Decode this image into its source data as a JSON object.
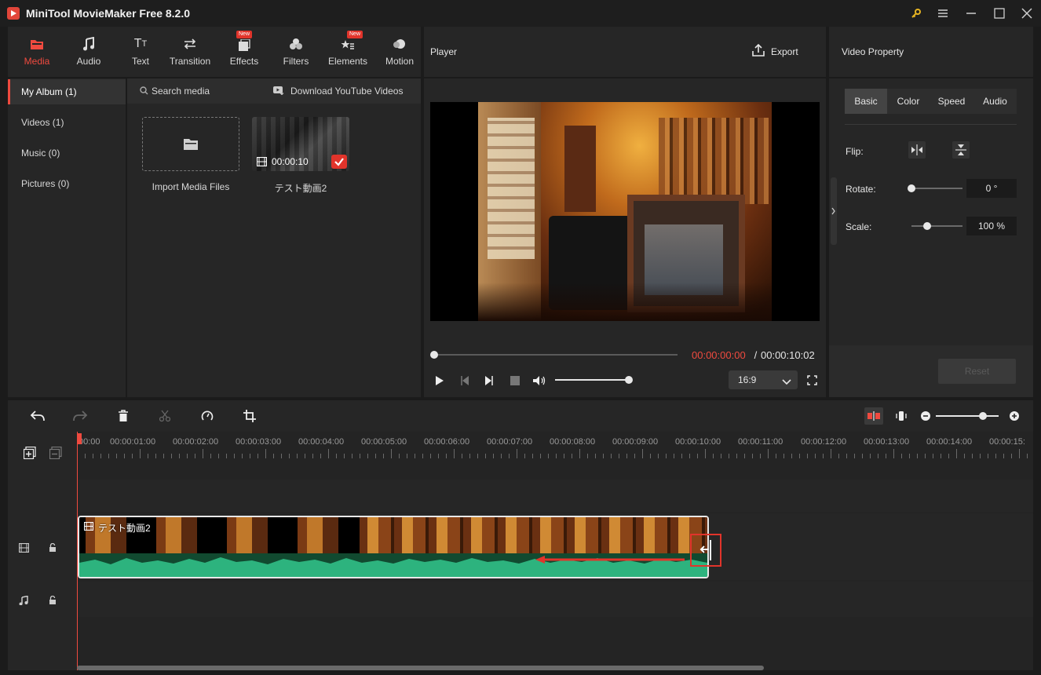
{
  "app": {
    "title": "MiniTool MovieMaker Free 8.2.0"
  },
  "toolbar": {
    "items": [
      {
        "label": "Media",
        "icon": "media-folder-icon",
        "active": true
      },
      {
        "label": "Audio",
        "icon": "music-note-icon"
      },
      {
        "label": "Text",
        "icon": "text-icon"
      },
      {
        "label": "Transition",
        "icon": "transition-arrows-icon"
      },
      {
        "label": "Effects",
        "icon": "effects-icon",
        "badge": "New"
      },
      {
        "label": "Filters",
        "icon": "filters-icon"
      },
      {
        "label": "Elements",
        "icon": "elements-icon",
        "badge": "New"
      },
      {
        "label": "Motion",
        "icon": "motion-icon"
      }
    ]
  },
  "album": {
    "items": [
      {
        "label": "My Album (1)"
      },
      {
        "label": "Videos (1)"
      },
      {
        "label": "Music (0)"
      },
      {
        "label": "Pictures (0)"
      }
    ]
  },
  "media": {
    "search_label": "Search media",
    "youtube_label": "Download YouTube Videos",
    "import_label": "Import Media Files",
    "clip_name": "テスト動画2",
    "clip_duration": "00:00:10"
  },
  "player": {
    "title": "Player",
    "export_label": "Export",
    "current_time": "00:00:00:00",
    "separator": " / ",
    "total_time": "00:00:10:02",
    "aspect": "16:9",
    "progress": 0,
    "volume": 1.0
  },
  "property": {
    "title": "Video Property",
    "tabs": [
      {
        "label": "Basic",
        "active": true
      },
      {
        "label": "Color"
      },
      {
        "label": "Speed"
      },
      {
        "label": "Audio"
      }
    ],
    "flip_label": "Flip:",
    "rotate_label": "Rotate:",
    "rotate_value": "0 °",
    "rotate_level": 0,
    "scale_label": "Scale:",
    "scale_value": "100 %",
    "scale_level": 0.3,
    "reset_label": "Reset"
  },
  "timeline": {
    "ruler": [
      "00:00",
      "00:00:01:00",
      "00:00:02:00",
      "00:00:03:00",
      "00:00:04:00",
      "00:00:05:00",
      "00:00:06:00",
      "00:00:07:00",
      "00:00:08:00",
      "00:00:09:00",
      "00:00:10:00",
      "00:00:11:00",
      "00:00:12:00",
      "00:00:13:00",
      "00:00:14:00",
      "00:00:15:"
    ],
    "clip_label": "テスト動画2",
    "zoom_level": 0.75
  },
  "colors": {
    "accent": "#ef4a3f",
    "audio_wave": "#2db37e",
    "bg": "#1b1b1b",
    "panel": "#262626"
  }
}
